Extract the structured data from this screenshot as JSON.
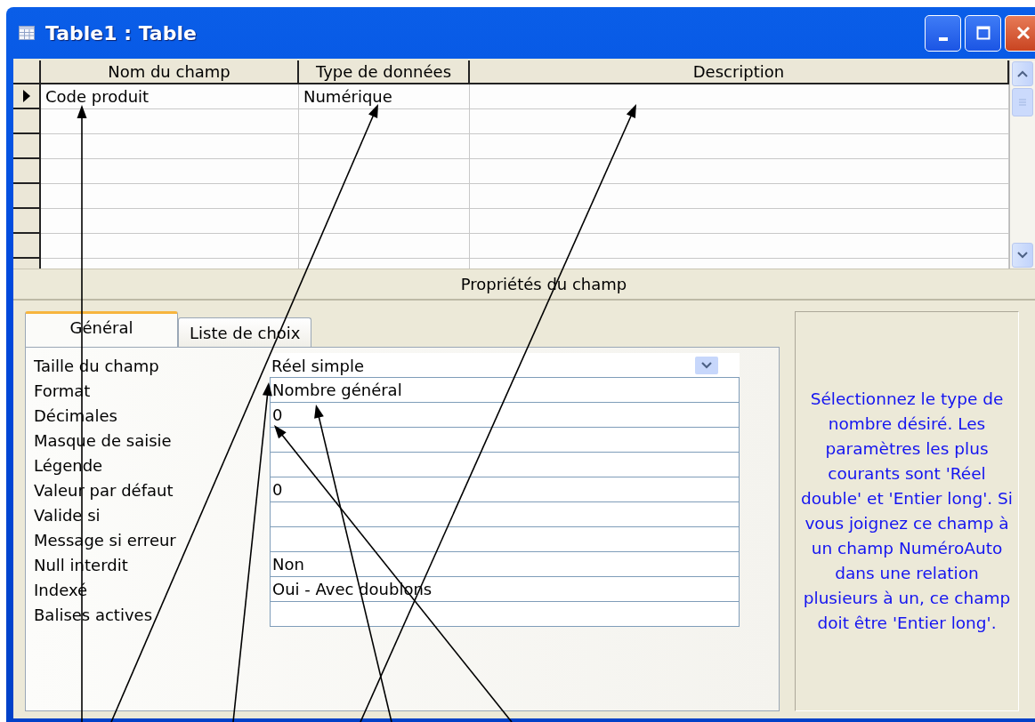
{
  "window": {
    "title": "Table1 : Table"
  },
  "grid": {
    "columns": [
      "Nom du champ",
      "Type de données",
      "Description"
    ],
    "rows": [
      {
        "field_name": "Code produit",
        "data_type": "Numérique",
        "current": true
      }
    ]
  },
  "properties_title": "Propriétés du champ",
  "tabs": [
    {
      "label": "Général",
      "selected": true
    },
    {
      "label": "Liste de choix",
      "selected": false
    }
  ],
  "properties": [
    {
      "label": "Taille du champ",
      "value": "Réel simple",
      "kind": "dropdown"
    },
    {
      "label": "Format",
      "value": "Nombre général",
      "kind": "text"
    },
    {
      "label": "Décimales",
      "value": "0",
      "kind": "text"
    },
    {
      "label": "Masque de saisie",
      "kind": "text"
    },
    {
      "label": "Légende",
      "kind": "text"
    },
    {
      "label": "Valeur par défaut",
      "value": "0",
      "kind": "text"
    },
    {
      "label": "Valide si",
      "kind": "text"
    },
    {
      "label": "Message si erreur",
      "kind": "text"
    },
    {
      "label": "Null interdit",
      "value": "Non",
      "kind": "text"
    },
    {
      "label": "Indexé",
      "value": "Oui - Avec doublons",
      "kind": "text"
    },
    {
      "label": "Balises actives",
      "kind": "text"
    }
  ],
  "help_text": "Sélectionnez le type de nombre désiré. Les paramètres les plus courants sont 'Réel double' et 'Entier long'. Si vous joignez ce champ à un champ NuméroAuto dans une relation plusieurs à un, ce champ doit être 'Entier long'."
}
